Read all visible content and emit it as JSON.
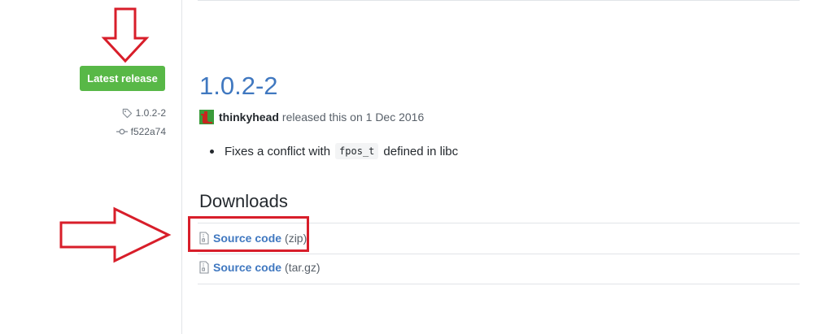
{
  "sidebar": {
    "latest_release_label": "Latest release",
    "tag": {
      "icon": "tag-icon",
      "value": "1.0.2-2"
    },
    "commit": {
      "icon": "commit-icon",
      "value": "f522a74"
    }
  },
  "release": {
    "title": "1.0.2-2",
    "author": "thinkyhead",
    "released_text": "released this on 1 Dec 2016",
    "notes": [
      {
        "before": "Fixes a conflict with",
        "code": "fpos_t",
        "after": "defined in libc"
      }
    ]
  },
  "downloads": {
    "heading": "Downloads",
    "assets": [
      {
        "icon": "file-zip-icon",
        "name": "Source code",
        "ext": "(zip)"
      },
      {
        "icon": "file-zip-icon",
        "name": "Source code",
        "ext": "(tar.gz)"
      }
    ]
  },
  "annotations": {
    "color": "#d81e2a",
    "arrows": [
      "down-arrow-annotation",
      "right-arrow-annotation"
    ]
  },
  "colors": {
    "badge_green": "#58b847",
    "link_blue": "#4078c0",
    "muted_text": "#586069"
  }
}
